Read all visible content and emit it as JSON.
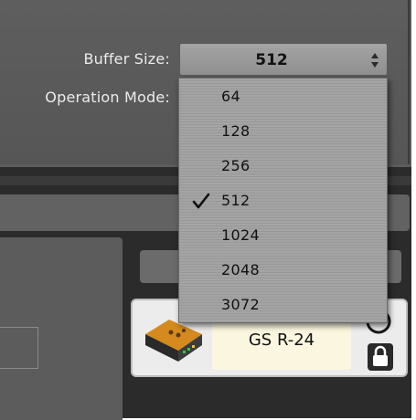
{
  "settings": {
    "buffer_size_label": "Buffer Size:",
    "buffer_size_value": "512",
    "operation_mode_label": "Operation Mode:"
  },
  "buffer_options": [
    "64",
    "128",
    "256",
    "512",
    "1024",
    "2048",
    "3072"
  ],
  "selected_option": "512",
  "device": {
    "name": "GS R-24"
  },
  "colors": {
    "dropdown_bg": "#a4a4a4",
    "panel_bg": "#5b5b5b",
    "device_name_bg": "#fbf6df",
    "frame_bg": "#2b2b2b"
  },
  "icons": [
    "stepper-arrows-icon",
    "checkmark-icon",
    "audio-interface-icon",
    "radio-circle-icon",
    "lock-icon"
  ]
}
